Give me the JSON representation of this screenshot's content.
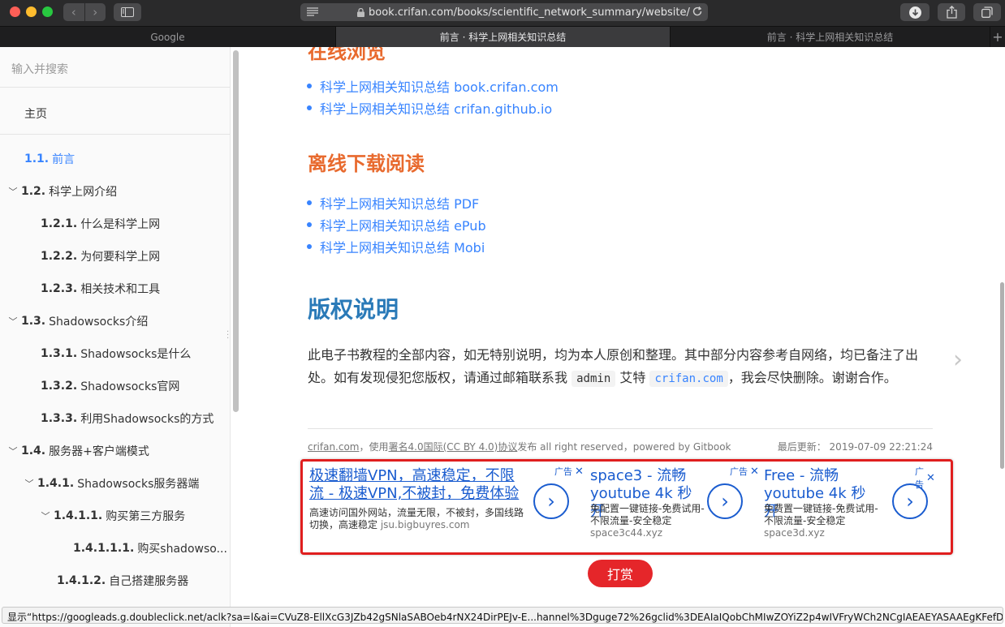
{
  "browser": {
    "url_display": "book.crifan.com/books/scientific_network_summary/website/",
    "tabs": [
      {
        "label": "Google",
        "active": false
      },
      {
        "label": "前言 · 科学上网相关知识总结",
        "active": true
      },
      {
        "label": "前言 · 科学上网相关知识总结",
        "active": false
      }
    ],
    "new_tab_label": "+",
    "status_text": "显示“https://googleads.g.doubleclick.net/aclk?sa=l&ai=CVuZ8-EllXcG3JZb42gSNlaSABOeb4rNX24DirPEJv-E...hannel%3Dguge72%26gclid%3DEAIaIQobChMIwZOYiZ2p4wIVFryWCh2NCgIAEAEYASAAEgKFefD_BwE”的菜单"
  },
  "sidebar": {
    "search_placeholder": "输入并搜索",
    "home": "主页",
    "items": [
      {
        "num": "1.1.",
        "label": "前言",
        "active": true
      },
      {
        "num": "1.2.",
        "label": "科学上网介绍"
      },
      {
        "num": "1.2.1.",
        "label": "什么是科学上网"
      },
      {
        "num": "1.2.2.",
        "label": "为何要科学上网"
      },
      {
        "num": "1.2.3.",
        "label": "相关技术和工具"
      },
      {
        "num": "1.3.",
        "label": "Shadowsocks介绍"
      },
      {
        "num": "1.3.1.",
        "label": "Shadowsocks是什么"
      },
      {
        "num": "1.3.2.",
        "label": "Shadowsocks官网"
      },
      {
        "num": "1.3.3.",
        "label": "利用Shadowsocks的方式"
      },
      {
        "num": "1.4.",
        "label": "服务器+客户端模式"
      },
      {
        "num": "1.4.1.",
        "label": "Shadowsocks服务器端"
      },
      {
        "num": "1.4.1.1.",
        "label": "购买第三方服务"
      },
      {
        "num": "1.4.1.1.1.",
        "label": "购买shadowso..."
      },
      {
        "num": "1.4.1.2.",
        "label": "自己搭建服务器"
      }
    ]
  },
  "content": {
    "cut_heading": "在线浏览",
    "offline_heading": "离线下载阅读",
    "online_links": [
      "科学上网相关知识总结 book.crifan.com",
      "科学上网相关知识总结 crifan.github.io"
    ],
    "offline_links": [
      "科学上网相关知识总结 PDF",
      "科学上网相关知识总结 ePub",
      "科学上网相关知识总结 Mobi"
    ],
    "copyright_heading": "版权说明",
    "para_part1": "此电子书教程的全部内容，如无特别说明，均为本人原创和整理。其中部分内容参考自网络，均已备注了出处。如有发现侵犯您版权，请通过邮箱联系我",
    "code_admin": "admin",
    "para_at": "艾特",
    "code_domain": "crifan.com",
    "para_part2": "，我会尽快删除。谢谢合作。",
    "footer_site": "crifan.com",
    "footer_text1": "，使用",
    "footer_license": "署名4.0国际(CC BY 4.0)协议",
    "footer_text2": "发布 all right reserved，powered by Gitbook",
    "footer_updated_label": "最后更新：",
    "footer_updated_value": "2019-07-09 22:21:24",
    "reward_label": "打赏"
  },
  "ads": [
    {
      "title": "极速翻墙VPN，高速稳定，不限流 - 极速VPN,不被封，免费体验",
      "desc": "高速访问国外网站，流量无限，不被封，多国线路切换，高速稳定",
      "domain": "jsu.bigbuyres.com",
      "badge": "广告"
    },
    {
      "title": "space3 - 流畅youtube 4k 秒开",
      "desc": "免配置一键链接-免费试用-不限流量-安全稳定",
      "domain": "space3c44.xyz",
      "badge": "广告"
    },
    {
      "title": "Free - 流畅youtube 4k 秒开",
      "desc": "免费置一键链接-免费试用-不限流量-安全稳定",
      "domain": "space3d.xyz",
      "badge": "广告"
    }
  ],
  "icons": {
    "back": "chevron-left-icon",
    "forward": "chevron-right-icon",
    "sidebar_toggle": "sidebar-icon",
    "lock": "lock-icon",
    "reload": "reload-icon",
    "download": "download-icon",
    "share": "share-icon",
    "tabs": "tabs-overview-icon"
  },
  "colors": {
    "link": "#3884ff",
    "heading_orange": "#e86a2e",
    "heading_blue": "#2a7ab8",
    "ad_border": "#e01e1e",
    "reward": "#e5262a"
  }
}
